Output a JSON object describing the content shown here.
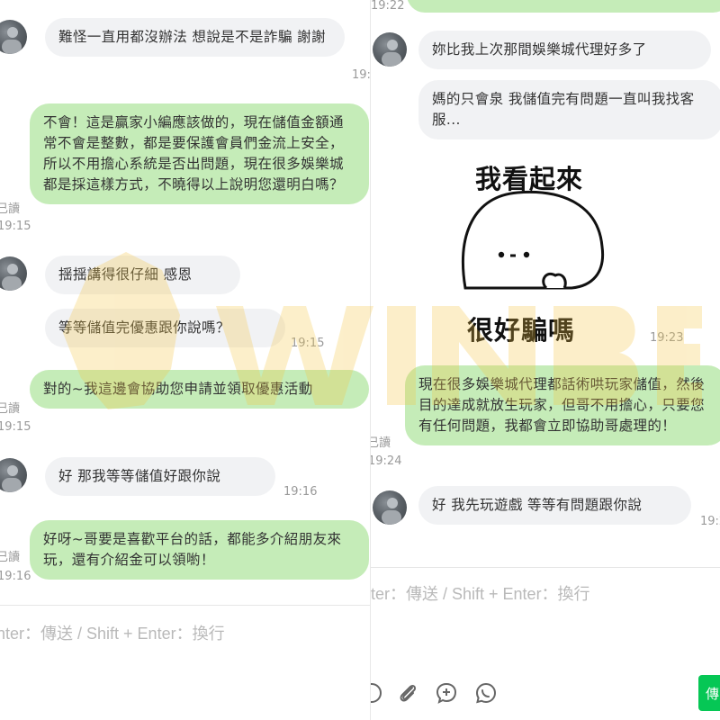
{
  "left": {
    "messages": [
      {
        "id": "l1",
        "dir": "in",
        "text": "難怪一直用都沒辦法  想說是不是詐騙   謝謝",
        "time": "19:"
      },
      {
        "id": "l2",
        "dir": "out",
        "text": "不會！這是贏家小編應該做的，現在儲值金額通常不會是整數，都是要保護會員們金流上安全，所以不用擔心系統是否出問題，現在很多娛樂城都是採這樣方式，不曉得以上說明您還明白嗎？",
        "read": "已讀",
        "time": "19:15"
      },
      {
        "id": "l3",
        "dir": "in",
        "text": "揺揺講得很仔細 感恩"
      },
      {
        "id": "l4",
        "dir": "in",
        "text": "等等儲值完優惠跟你說嗎？",
        "time": "19:15"
      },
      {
        "id": "l5",
        "dir": "out",
        "text": "對的~我這邊會協助您申請並領取優惠活動",
        "read": "已讀",
        "time": "19:15"
      },
      {
        "id": "l6",
        "dir": "in",
        "text": "好 那我等等儲值好跟你說",
        "time": "19:16"
      },
      {
        "id": "l7",
        "dir": "out",
        "text": "好呀~哥要是喜歡平台的話，都能多介紹朋友來玩，還有介紹金可以領喲！",
        "read": "已讀",
        "time": "19:16"
      }
    ],
    "input_hint": "nter：傳送 / Shift + Enter：換行"
  },
  "right": {
    "top_time": "19:22",
    "messages": [
      {
        "id": "r1",
        "dir": "in",
        "text": "妳比我上次那間娛樂城代理好多了"
      },
      {
        "id": "r2",
        "dir": "in",
        "text": "媽的只會泉 我儲值完有問題一直叫我找客服..."
      },
      {
        "id": "r3",
        "dir": "out",
        "text": "現在很多娛樂城代理都話術哄玩家儲值，然後目的達成就放生玩家，但哥不用擔心，只要您有任何問題，我都會立即協助哥處理的！",
        "read": "已讀",
        "time": "19:24"
      },
      {
        "id": "r4",
        "dir": "in",
        "text": "好 我先玩遊戲 等等有問題跟你說",
        "time": "19:2"
      }
    ],
    "sticker": {
      "top_text": "我看起來",
      "bottom_text": "很好騙嗎",
      "time": "19:23"
    },
    "input_hint": "ter：傳送 / Shift + Enter：換行",
    "send_label": "傳",
    "toolbar_icons": [
      "emoji-icon",
      "paperclip-icon",
      "add-comment-icon",
      "whatsapp-icon"
    ]
  },
  "watermark": {
    "text": "WINBET"
  },
  "colors": {
    "incoming": "#f1f2f4",
    "outgoing": "#c5ecb8",
    "send": "#06c755",
    "watermark": "#f5c542"
  }
}
